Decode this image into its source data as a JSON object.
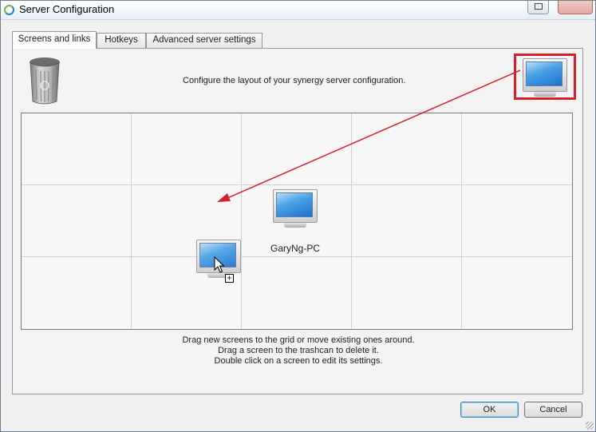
{
  "window": {
    "title": "Server Configuration",
    "icons": {
      "app": "synergy-app-icon",
      "help": "help-icon",
      "close": "close-icon"
    }
  },
  "tabs": [
    {
      "label": "Screens and links",
      "active": true
    },
    {
      "label": "Hotkeys",
      "active": false
    },
    {
      "label": "Advanced server settings",
      "active": false
    }
  ],
  "screens_tab": {
    "instruction": "Configure the layout of your synergy server configuration.",
    "trash_icon": "trashcan-icon",
    "new_screen_icon": "monitor-icon",
    "grid": {
      "columns": 5,
      "rows": 3
    },
    "screens": [
      {
        "name": "GaryNg-PC",
        "column": 3,
        "row": 2
      }
    ],
    "dragging_screen": {
      "column": 2,
      "row": 3,
      "icon": "monitor-icon",
      "cursor": "cursor-copy-icon"
    },
    "help_lines": [
      "Drag new screens to the grid or move existing ones around.",
      "Drag a screen to the trashcan to delete it.",
      "Double click on a screen to edit its settings."
    ],
    "annotation": {
      "color": "#d6202a"
    }
  },
  "buttons": {
    "ok": "OK",
    "cancel": "Cancel"
  }
}
